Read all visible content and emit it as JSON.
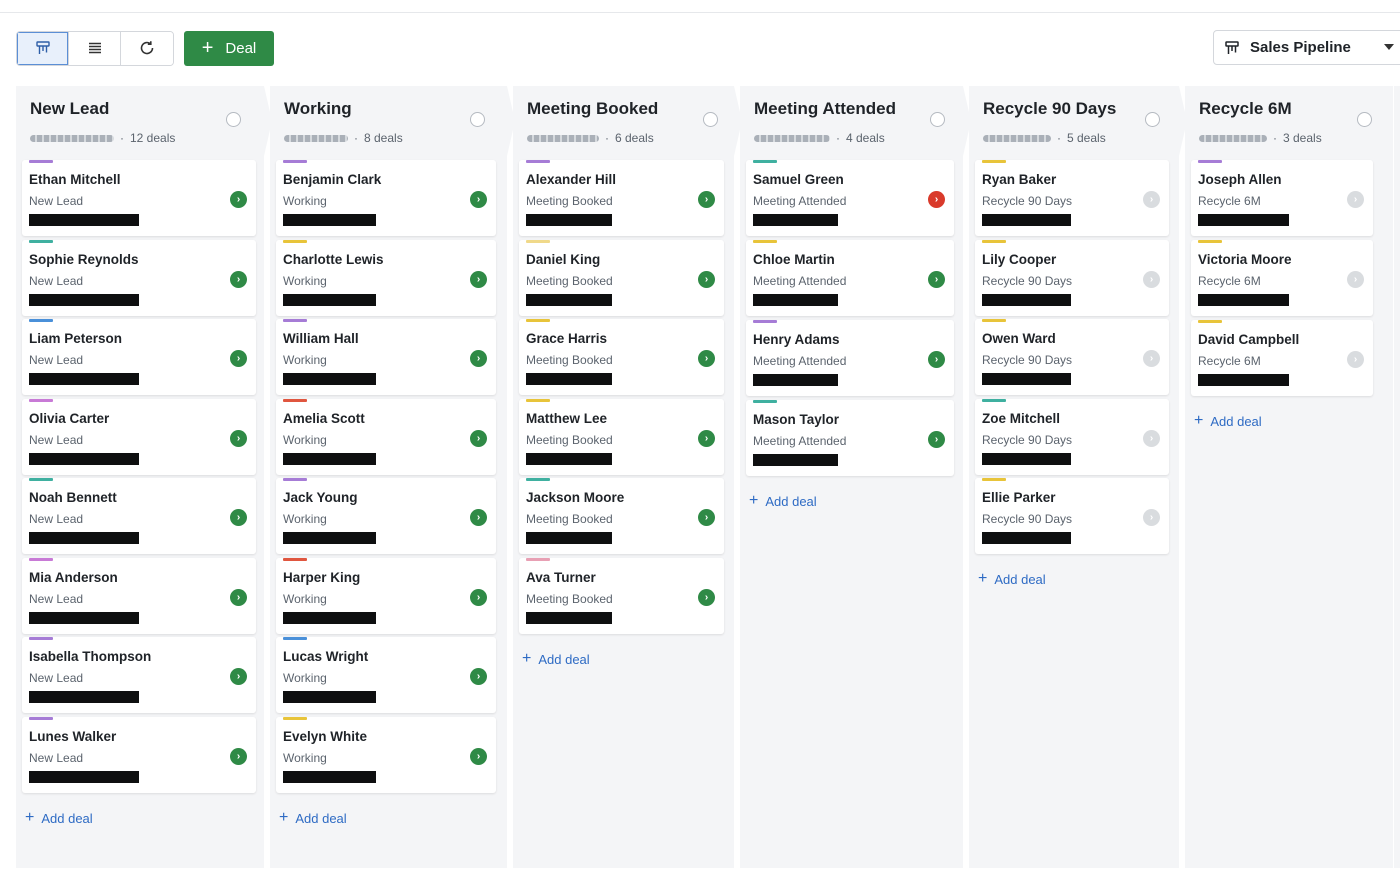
{
  "toolbar": {
    "views": [
      {
        "icon": "kanban-icon",
        "active": true
      },
      {
        "icon": "list-icon",
        "active": false
      },
      {
        "icon": "refresh-icon",
        "active": false
      }
    ],
    "deal_button_label": "Deal",
    "deal_button_icon": "plus-icon"
  },
  "pipeline_selector": {
    "label": "Sales Pipeline",
    "icon": "kanban-icon"
  },
  "colors": {
    "accent_green": "#2f8a46",
    "link_blue": "#2e6bc4",
    "alert_red": "#d93a2b"
  },
  "add_deal_label": "Add deal",
  "columns": [
    {
      "title": "New Lead",
      "count": "12 deals",
      "cards": [
        {
          "name": "Ethan Mitchell",
          "stage": "New Lead",
          "tag": "#a67cd6",
          "status": "green"
        },
        {
          "name": "Sophie Reynolds",
          "stage": "New Lead",
          "tag": "#3fb0a0",
          "status": "green"
        },
        {
          "name": "Liam Peterson",
          "stage": "New Lead",
          "tag": "#4a90d9",
          "status": "green"
        },
        {
          "name": "Olivia Carter",
          "stage": "New Lead",
          "tag": "#c87ad6",
          "status": "green"
        },
        {
          "name": "Noah Bennett",
          "stage": "New Lead",
          "tag": "#3fb0a0",
          "status": "green"
        },
        {
          "name": "Mia Anderson",
          "stage": "New Lead",
          "tag": "#c87ad6",
          "status": "green"
        },
        {
          "name": "Isabella Thompson",
          "stage": "New Lead",
          "tag": "#a67cd6",
          "status": "green"
        },
        {
          "name": "Lunes Walker",
          "stage": "New Lead",
          "tag": "#a67cd6",
          "status": "green"
        }
      ]
    },
    {
      "title": "Working",
      "count": "8 deals",
      "cards": [
        {
          "name": "Benjamin Clark",
          "stage": "Working",
          "tag": "#a67cd6",
          "status": "green"
        },
        {
          "name": "Charlotte Lewis",
          "stage": "Working",
          "tag": "#e8c43a",
          "status": "green"
        },
        {
          "name": "William Hall",
          "stage": "Working",
          "tag": "#a67cd6",
          "status": "green"
        },
        {
          "name": "Amelia Scott",
          "stage": "Working",
          "tag": "#e0563f",
          "status": "green"
        },
        {
          "name": "Jack Young",
          "stage": "Working",
          "tag": "#a67cd6",
          "status": "green"
        },
        {
          "name": "Harper King",
          "stage": "Working",
          "tag": "#e0563f",
          "status": "green"
        },
        {
          "name": "Lucas Wright",
          "stage": "Working",
          "tag": "#4a90d9",
          "status": "green"
        },
        {
          "name": "Evelyn White",
          "stage": "Working",
          "tag": "#e8c43a",
          "status": "green"
        }
      ]
    },
    {
      "title": "Meeting Booked",
      "count": "6 deals",
      "cards": [
        {
          "name": "Alexander Hill",
          "stage": "Meeting Booked",
          "tag": "#a67cd6",
          "status": "green"
        },
        {
          "name": "Daniel King",
          "stage": "Meeting Booked",
          "tag": "#f0d98a",
          "status": "green"
        },
        {
          "name": "Grace Harris",
          "stage": "Meeting Booked",
          "tag": "#e8c43a",
          "status": "green"
        },
        {
          "name": "Matthew Lee",
          "stage": "Meeting Booked",
          "tag": "#e8c43a",
          "status": "green"
        },
        {
          "name": "Jackson Moore",
          "stage": "Meeting Booked",
          "tag": "#3fb0a0",
          "status": "green"
        },
        {
          "name": "Ava Turner",
          "stage": "Meeting Booked",
          "tag": "#e8a0b4",
          "status": "green"
        }
      ]
    },
    {
      "title": "Meeting Attended",
      "count": "4 deals",
      "cards": [
        {
          "name": "Samuel Green",
          "stage": "Meeting Attended",
          "tag": "#3fb0a0",
          "status": "red"
        },
        {
          "name": "Chloe Martin",
          "stage": "Meeting Attended",
          "tag": "#e8c43a",
          "status": "green"
        },
        {
          "name": "Henry Adams",
          "stage": "Meeting Attended",
          "tag": "#a67cd6",
          "status": "green"
        },
        {
          "name": "Mason Taylor",
          "stage": "Meeting Attended",
          "tag": "#3fb0a0",
          "status": "green"
        }
      ]
    },
    {
      "title": "Recycle 90 Days",
      "count": "5 deals",
      "cards": [
        {
          "name": "Ryan Baker",
          "stage": "Recycle 90 Days",
          "tag": "#e8c43a",
          "status": "grey"
        },
        {
          "name": "Lily Cooper",
          "stage": "Recycle 90 Days",
          "tag": "#e8c43a",
          "status": "grey"
        },
        {
          "name": "Owen Ward",
          "stage": "Recycle 90 Days",
          "tag": "#e8c43a",
          "status": "grey"
        },
        {
          "name": "Zoe Mitchell",
          "stage": "Recycle 90 Days",
          "tag": "#3fb0a0",
          "status": "grey"
        },
        {
          "name": "Ellie Parker",
          "stage": "Recycle 90 Days",
          "tag": "#e8c43a",
          "status": "grey"
        }
      ]
    },
    {
      "title": "Recycle 6M",
      "count": "3 deals",
      "cards": [
        {
          "name": "Joseph Allen",
          "stage": "Recycle 6M",
          "tag": "#a67cd6",
          "status": "grey"
        },
        {
          "name": "Victoria Moore",
          "stage": "Recycle 6M",
          "tag": "#e8c43a",
          "status": "grey"
        },
        {
          "name": "David Campbell",
          "stage": "Recycle 6M",
          "tag": "#e8c43a",
          "status": "grey"
        }
      ]
    }
  ]
}
